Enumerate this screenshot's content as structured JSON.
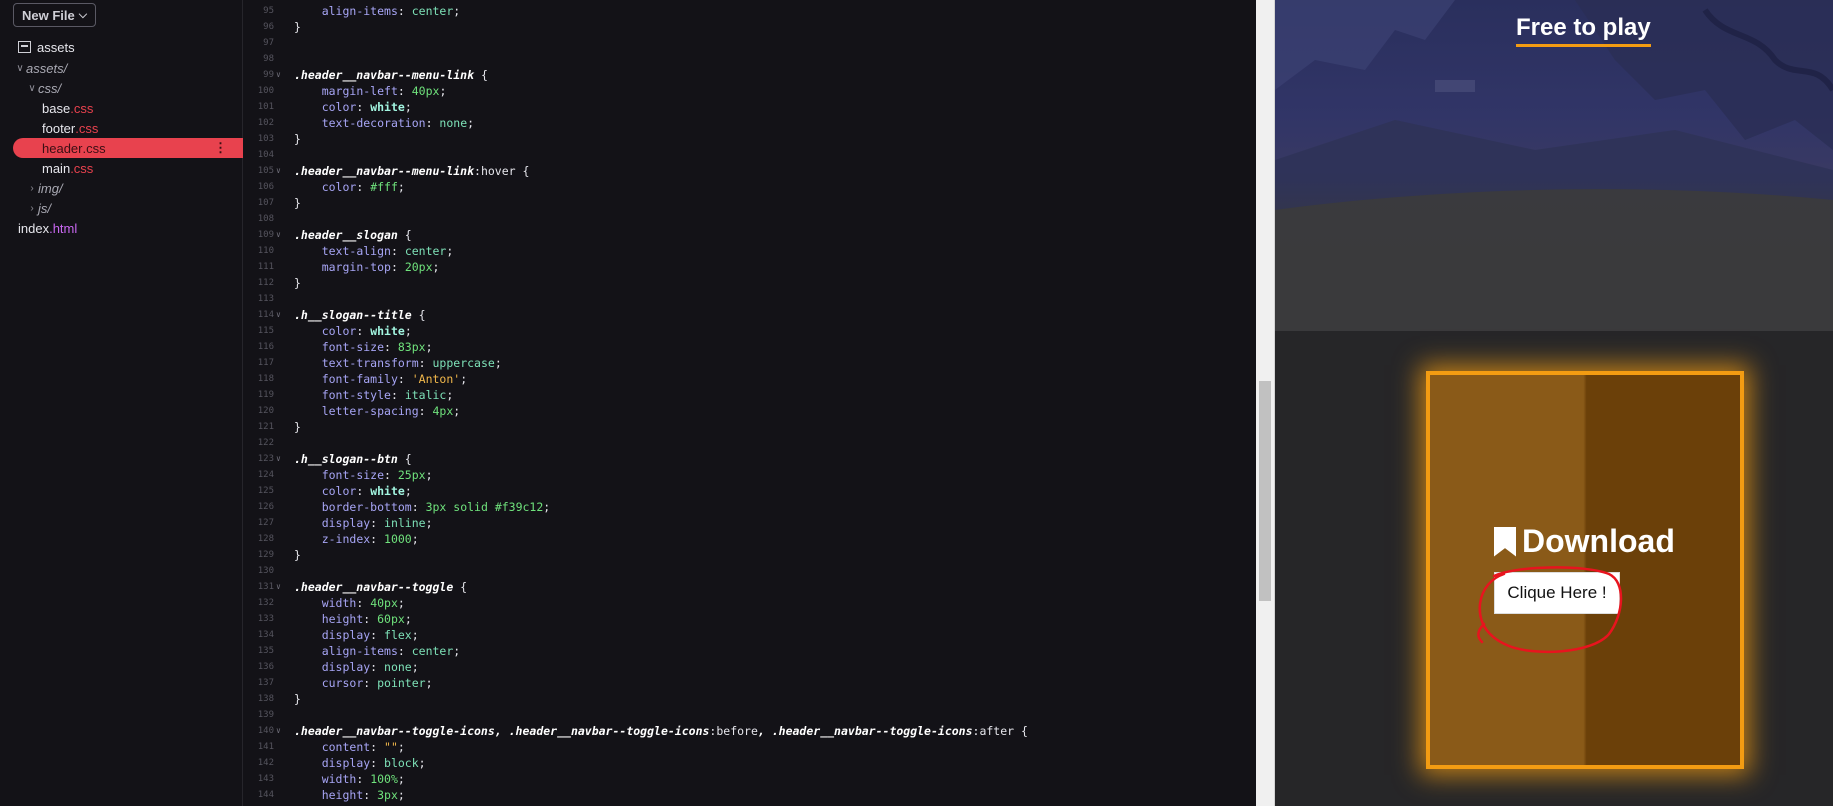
{
  "sidebar": {
    "new_file_label": "New File",
    "items": [
      {
        "label": "assets",
        "ext": ""
      },
      {
        "label": "assets/",
        "ext": ""
      },
      {
        "label": "css/",
        "ext": ""
      },
      {
        "label": "base",
        "ext": ".css"
      },
      {
        "label": "footer",
        "ext": ".css"
      },
      {
        "label": "header",
        "ext": ".css"
      },
      {
        "label": "main",
        "ext": ".css"
      },
      {
        "label": "img/",
        "ext": ""
      },
      {
        "label": "js/",
        "ext": ""
      },
      {
        "label": "index",
        "ext": ".html"
      }
    ],
    "selected_item": "header.css"
  },
  "editor": {
    "language": "css",
    "lines": [
      {
        "n": "95",
        "text": "    align-items: center;"
      },
      {
        "n": "96",
        "text": "}"
      },
      {
        "n": "97",
        "text": ""
      },
      {
        "n": "98",
        "text": ""
      },
      {
        "n": "99",
        "text": ".header__navbar--menu-link {"
      },
      {
        "n": "100",
        "text": "    margin-left: 40px;"
      },
      {
        "n": "101",
        "text": "    color: white;"
      },
      {
        "n": "102",
        "text": "    text-decoration: none;"
      },
      {
        "n": "103",
        "text": "}"
      },
      {
        "n": "104",
        "text": ""
      },
      {
        "n": "105",
        "text": ".header__navbar--menu-link:hover {"
      },
      {
        "n": "106",
        "text": "    color: #fff;"
      },
      {
        "n": "107",
        "text": "}"
      },
      {
        "n": "108",
        "text": ""
      },
      {
        "n": "109",
        "text": ".header__slogan {"
      },
      {
        "n": "110",
        "text": "    text-align: center;"
      },
      {
        "n": "111",
        "text": "    margin-top: 20px;"
      },
      {
        "n": "112",
        "text": "}"
      },
      {
        "n": "113",
        "text": ""
      },
      {
        "n": "114",
        "text": ".h__slogan--title {"
      },
      {
        "n": "115",
        "text": "    color: white;"
      },
      {
        "n": "116",
        "text": "    font-size: 83px;"
      },
      {
        "n": "117",
        "text": "    text-transform: uppercase;"
      },
      {
        "n": "118",
        "text": "    font-family: 'Anton';"
      },
      {
        "n": "119",
        "text": "    font-style: italic;"
      },
      {
        "n": "120",
        "text": "    letter-spacing: 4px;"
      },
      {
        "n": "121",
        "text": "}"
      },
      {
        "n": "122",
        "text": ""
      },
      {
        "n": "123",
        "text": ".h__slogan--btn {"
      },
      {
        "n": "124",
        "text": "    font-size: 25px;"
      },
      {
        "n": "125",
        "text": "    color: white;"
      },
      {
        "n": "126",
        "text": "    border-bottom: 3px solid #f39c12;"
      },
      {
        "n": "127",
        "text": "    display: inline;"
      },
      {
        "n": "128",
        "text": "    z-index: 1000;"
      },
      {
        "n": "129",
        "text": "}"
      },
      {
        "n": "130",
        "text": ""
      },
      {
        "n": "131",
        "text": ".header__navbar--toggle {"
      },
      {
        "n": "132",
        "text": "    width: 40px;"
      },
      {
        "n": "133",
        "text": "    height: 60px;"
      },
      {
        "n": "134",
        "text": "    display: flex;"
      },
      {
        "n": "135",
        "text": "    align-items: center;"
      },
      {
        "n": "136",
        "text": "    display: none;"
      },
      {
        "n": "137",
        "text": "    cursor: pointer;"
      },
      {
        "n": "138",
        "text": "}"
      },
      {
        "n": "139",
        "text": ""
      },
      {
        "n": "140",
        "text": ".header__navbar--toggle-icons, .header__navbar--toggle-icons:before, .header__navbar--toggle-icons:after {"
      },
      {
        "n": "141",
        "text": "    content: \"\";"
      },
      {
        "n": "142",
        "text": "    display: block;"
      },
      {
        "n": "143",
        "text": "    width: 100%;"
      },
      {
        "n": "144",
        "text": "    height: 3px;"
      }
    ]
  },
  "preview": {
    "slogan_button": "Free to play",
    "download_title": "Download",
    "download_button": "Clique Here !",
    "accent_color": "#f39c12"
  }
}
